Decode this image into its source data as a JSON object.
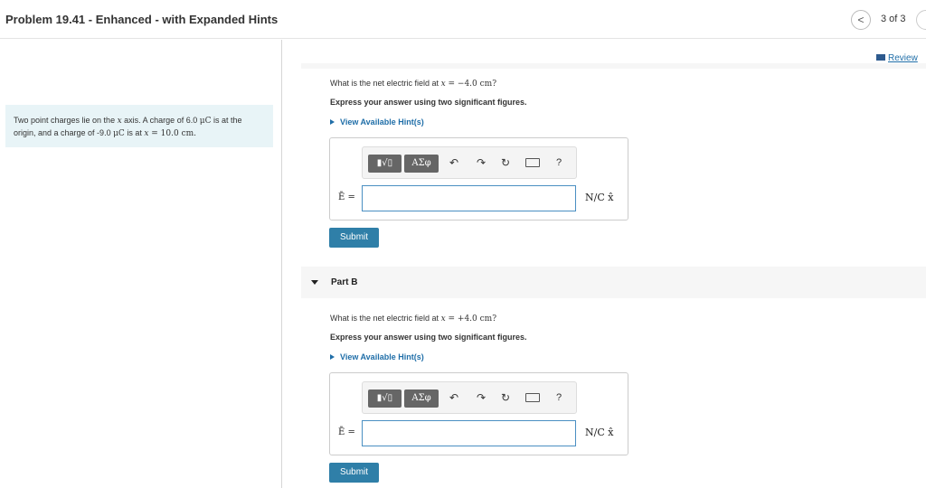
{
  "header": {
    "title": "Problem 19.41 - Enhanced - with Expanded Hints",
    "nav_prev": "<",
    "page_count": "3 of 3"
  },
  "review": {
    "label": "Review"
  },
  "problem": {
    "t1": "Two point charges lie on the ",
    "x1": "x",
    "t2": " axis. A charge of 6.0 ",
    "u1": "μC",
    "t3": " is at the origin, and a charge of -9.0 ",
    "u2": "μC",
    "t4": " is at ",
    "x2": "x",
    "t5": " = 10.0 cm."
  },
  "part_a": {
    "q_prefix": "What is the net electric field at ",
    "q_var": "x",
    "q_value": " = −4.0 cm?",
    "instruction": "Express your answer using two significant figures.",
    "hint_link": "View Available Hint(s)",
    "input_label": "Ē =",
    "input_value": "",
    "units": "N/C x̂",
    "submit": "Submit"
  },
  "part_b": {
    "label": "Part B",
    "q_prefix": "What is the net electric field at ",
    "q_var": "x",
    "q_value": " = +4.0 cm?",
    "instruction": "Express your answer using two significant figures.",
    "hint_link": "View Available Hint(s)",
    "input_label": "Ē =",
    "input_value": "",
    "units": "N/C x̂",
    "submit": "Submit"
  },
  "toolbar": {
    "templates_label": "▮√▯",
    "symbols_label": "ΑΣφ",
    "undo_icon": "↶",
    "redo_icon": "↷",
    "reset_icon": "↻",
    "help_label": "?"
  },
  "icons": {
    "undo": "undo-icon",
    "redo": "redo-icon",
    "reset": "reset-icon",
    "keyboard": "keyboard-icon",
    "help": "help-icon",
    "hint_toggle": "triangle-right-icon",
    "part_toggle": "caret-down-icon",
    "review": "review-icon"
  },
  "colors": {
    "link": "#1f6ea8",
    "submit": "#2f7fa8",
    "problem_bg": "#e8f4f7",
    "input_border": "#4a8fc2"
  }
}
